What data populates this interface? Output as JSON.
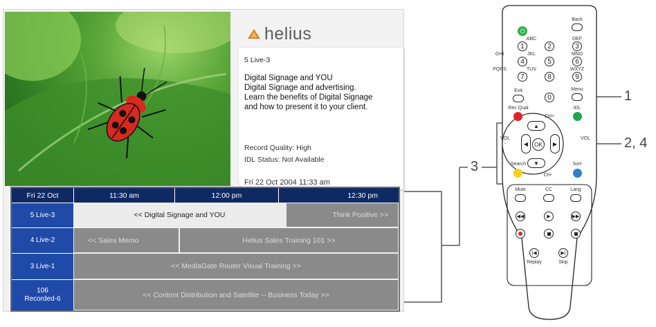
{
  "brand": {
    "name": "helius",
    "icon": "helius-logo-icon"
  },
  "info_panel": {
    "channel": "5 Live-3",
    "description_lines": [
      "Digital Signage and YOU",
      "Digital Signage and advertising.",
      "Learn the benefits of Digital Signage",
      "and how to present it to your client."
    ],
    "record_quality": "Record Quality: High",
    "idl_status": "IDL Status:  Not Available",
    "datetime": "Fri  22 Oct 2004  11:33 am"
  },
  "epg": {
    "header": {
      "date": "Fri 22 Oct",
      "times": [
        "11:30 am",
        "12:00 pm",
        "12:30 pm"
      ]
    },
    "rows": [
      {
        "channel": "5 Live-3",
        "programs": [
          "<< Digital Signage and YOU",
          "Think Positive >>"
        ]
      },
      {
        "channel": "4 Live-2",
        "programs": [
          "<< Sales Memo",
          "Helius Sales Training 101 >>"
        ]
      },
      {
        "channel": "3 Live-1",
        "programs": [
          "<< MediaGate Router Visual Training >>"
        ]
      },
      {
        "channel_line1": "106",
        "channel_line2": "Recorded-6",
        "programs": [
          "<< Content Distribution and Satellite --  Business Today >>"
        ]
      }
    ]
  },
  "callouts": {
    "c1": "1",
    "c24": "2, 4",
    "c3": "3"
  },
  "remote": {
    "back": "Back",
    "numbers": [
      "1",
      "2",
      "3",
      "4",
      "5",
      "6",
      "7",
      "8",
      "9",
      "0"
    ],
    "letters": {
      "k2": "ABC",
      "k3": "DEF",
      "k4": "GHI",
      "k5": "JKL",
      "k6": "MNO",
      "k7": "PQRS",
      "k8": "TUV",
      "k9": "WXYZ"
    },
    "exit": "Exit",
    "menu": "Menu",
    "rec_qual": "Rec Qual",
    "idl": "IDL",
    "ch_plus": "CH+",
    "ch_minus": "CH-",
    "vol_minus_1": "VOL",
    "vol_minus_2": "-",
    "vol_plus": "VOL",
    "ok": "OK",
    "search": "Search",
    "sort": "Sort",
    "mute": "Mute",
    "cc": "CC",
    "lang": "Lang",
    "replay": "Replay",
    "skip": "Skip",
    "colors": {
      "power": "#2bb34a",
      "red": "#e0242b",
      "green": "#1fa84a",
      "yellow": "#f4d21c",
      "blue": "#2f7fc6",
      "rec": "#e0242b"
    }
  }
}
